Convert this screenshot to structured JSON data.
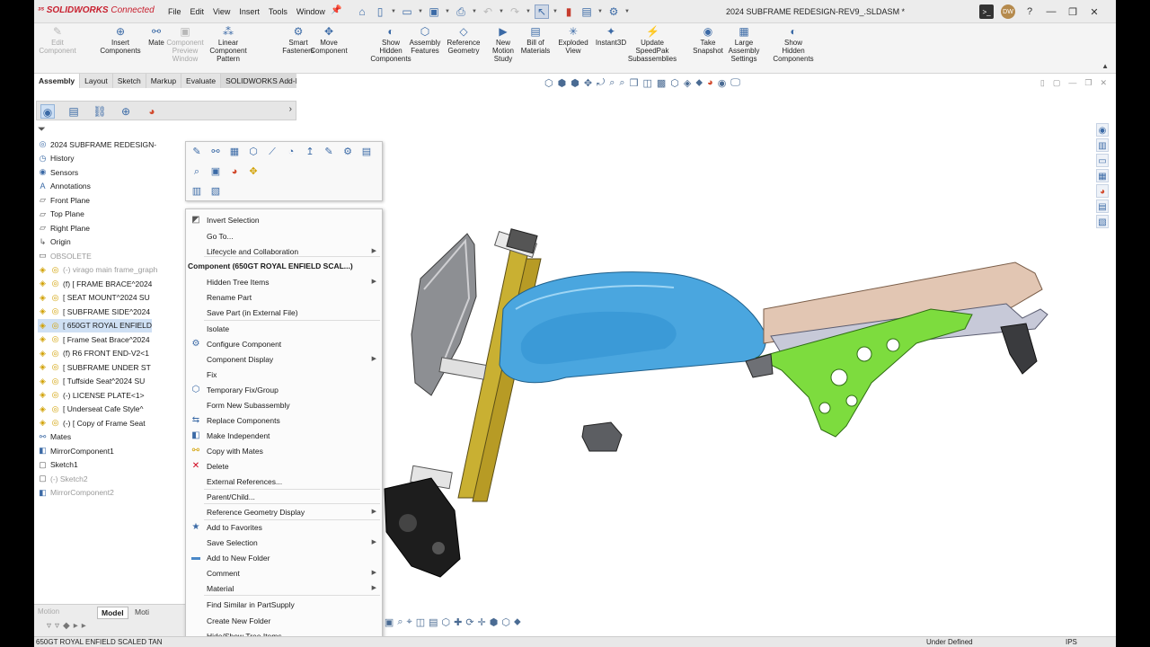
{
  "app": {
    "logo": "SOLIDWORKS",
    "logo_suffix": "Connected",
    "document_title": "2024 SUBFRAME REDESIGN-REV9_.SLDASM *"
  },
  "menubar": [
    "File",
    "Edit",
    "View",
    "Insert",
    "Tools",
    "Window"
  ],
  "window_controls": {
    "avatar_initials": "DW"
  },
  "ribbon": [
    {
      "label": "Edit\nComponent",
      "icon": "edit-component-icon",
      "disabled": true
    },
    {
      "label": "Insert\nComponents",
      "icon": "insert-components-icon",
      "disabled": false
    },
    {
      "label": "Mate",
      "icon": "mate-icon",
      "disabled": false
    },
    {
      "label": "Component\nPreview\nWindow",
      "icon": "preview-window-icon",
      "disabled": true
    },
    {
      "label": "Linear Component\nPattern",
      "icon": "pattern-icon",
      "disabled": false
    },
    {
      "label": "Smart\nFasteners",
      "icon": "fastener-icon",
      "disabled": false
    },
    {
      "label": "Move\nComponent",
      "icon": "move-icon",
      "disabled": false
    },
    {
      "label": "Show\nHidden\nComponents",
      "icon": "show-hidden-icon",
      "disabled": false
    },
    {
      "label": "Assembly\nFeatures",
      "icon": "assembly-features-icon",
      "disabled": false
    },
    {
      "label": "Reference\nGeometry",
      "icon": "reference-geometry-icon",
      "disabled": false
    },
    {
      "label": "New\nMotion\nStudy",
      "icon": "motion-study-icon",
      "disabled": false
    },
    {
      "label": "Bill of\nMaterials",
      "icon": "bom-icon",
      "disabled": false
    },
    {
      "label": "Exploded\nView",
      "icon": "exploded-view-icon",
      "disabled": false
    },
    {
      "label": "Instant3D",
      "icon": "instant3d-icon",
      "disabled": false
    },
    {
      "label": "Update\nSpeedPak\nSubassemblies",
      "icon": "speedpak-icon",
      "disabled": false
    },
    {
      "label": "Take\nSnapshot",
      "icon": "snapshot-icon",
      "disabled": false
    },
    {
      "label": "Large\nAssembly\nSettings",
      "icon": "large-assembly-icon",
      "disabled": false
    },
    {
      "label": "Show\nHidden\nComponents",
      "icon": "show-hidden-icon",
      "disabled": false
    }
  ],
  "command_tabs": [
    "Assembly",
    "Layout",
    "Sketch",
    "Markup",
    "Evaluate",
    "SOLIDWORKS Add-Ins"
  ],
  "tree": [
    {
      "label": "2024 SUBFRAME REDESIGN-",
      "icon": "assembly-icon",
      "dim": false,
      "hl": false
    },
    {
      "label": "History",
      "icon": "history-icon",
      "dim": false,
      "hl": false
    },
    {
      "label": "Sensors",
      "icon": "sensors-icon",
      "dim": false,
      "hl": false
    },
    {
      "label": "Annotations",
      "icon": "annotations-icon",
      "dim": false,
      "hl": false
    },
    {
      "label": "Front Plane",
      "icon": "plane-icon",
      "dim": false,
      "hl": false
    },
    {
      "label": "Top Plane",
      "icon": "plane-icon",
      "dim": false,
      "hl": false
    },
    {
      "label": "Right Plane",
      "icon": "plane-icon",
      "dim": false,
      "hl": false
    },
    {
      "label": "Origin",
      "icon": "origin-icon",
      "dim": false,
      "hl": false
    },
    {
      "label": "OBSOLETE",
      "icon": "folder-icon",
      "dim": true,
      "hl": false
    },
    {
      "label": "(-) virago main frame_graph",
      "icon": "part-icon",
      "dim": true,
      "hl": false
    },
    {
      "label": "(f) [ FRAME BRACE^2024",
      "icon": "part-icon",
      "dim": false,
      "hl": false
    },
    {
      "label": "[ SEAT MOUNT^2024 SU",
      "icon": "part-icon",
      "dim": false,
      "hl": false
    },
    {
      "label": "[ SUBFRAME SIDE^2024",
      "icon": "part-icon",
      "dim": false,
      "hl": false
    },
    {
      "label": "[ 650GT ROYAL ENFIELD",
      "icon": "part-icon",
      "dim": false,
      "hl": true
    },
    {
      "label": "[ Frame Seat Brace^2024",
      "icon": "part-icon",
      "dim": false,
      "hl": false
    },
    {
      "label": "(f) R6 FRONT END-V2<1",
      "icon": "part-icon",
      "dim": false,
      "hl": false
    },
    {
      "label": "[ SUBFRAME UNDER ST",
      "icon": "part-icon",
      "dim": false,
      "hl": false
    },
    {
      "label": "[ Tuffside Seat^2024 SU",
      "icon": "part-icon",
      "dim": false,
      "hl": false
    },
    {
      "label": "(-) LICENSE PLATE<1>",
      "icon": "part-icon",
      "dim": false,
      "hl": false
    },
    {
      "label": "[ Underseat Cafe Style^",
      "icon": "part-icon",
      "dim": false,
      "hl": false
    },
    {
      "label": "(-) [ Copy of Frame Seat",
      "icon": "part-icon",
      "dim": false,
      "hl": false
    },
    {
      "label": "Mates",
      "icon": "mates-icon",
      "dim": false,
      "hl": false
    },
    {
      "label": "MirrorComponent1",
      "icon": "mirror-icon",
      "dim": false,
      "hl": false
    },
    {
      "label": "Sketch1",
      "icon": "sketch-icon",
      "dim": false,
      "hl": false
    },
    {
      "label": "(-) Sketch2",
      "icon": "sketch-icon",
      "dim": true,
      "hl": false
    },
    {
      "label": "MirrorComponent2",
      "icon": "mirror-icon",
      "dim": true,
      "hl": false
    }
  ],
  "fm_bottom": {
    "model_tab": "Model",
    "motion_tab": "Moti",
    "motion_label": "Motion"
  },
  "context_menu": [
    {
      "label": "Invert Selection",
      "icon": "invert-selection-icon",
      "sub": false,
      "header": false
    },
    {
      "label": "Go To...",
      "icon": "",
      "sub": false,
      "header": false
    },
    {
      "label": "Lifecycle and Collaboration",
      "icon": "",
      "sub": true,
      "header": false
    },
    {
      "label": "Component (650GT ROYAL ENFIELD SCAL...)",
      "icon": "",
      "sub": false,
      "header": true
    },
    {
      "label": "Hidden Tree Items",
      "icon": "",
      "sub": true,
      "header": false
    },
    {
      "label": "Rename Part",
      "icon": "",
      "sub": false,
      "header": false
    },
    {
      "label": "Save Part (in External File)",
      "icon": "",
      "sub": false,
      "header": false
    },
    {
      "label": "Isolate",
      "icon": "",
      "sub": false,
      "header": false
    },
    {
      "label": "Configure Component",
      "icon": "configure-icon",
      "sub": false,
      "header": false
    },
    {
      "label": "Component Display",
      "icon": "",
      "sub": true,
      "header": false
    },
    {
      "label": "Fix",
      "icon": "",
      "sub": false,
      "header": false
    },
    {
      "label": "Temporary Fix/Group",
      "icon": "fix-group-icon",
      "sub": false,
      "header": false
    },
    {
      "label": "Form New Subassembly",
      "icon": "",
      "sub": false,
      "header": false
    },
    {
      "label": "Replace Components",
      "icon": "replace-icon",
      "sub": false,
      "header": false
    },
    {
      "label": "Make Independent",
      "icon": "independent-icon",
      "sub": false,
      "header": false
    },
    {
      "label": "Copy with Mates",
      "icon": "copy-mates-icon",
      "sub": false,
      "header": false
    },
    {
      "label": "Delete",
      "icon": "delete-icon",
      "sub": false,
      "header": false
    },
    {
      "label": "External References...",
      "icon": "",
      "sub": false,
      "header": false
    },
    {
      "label": "Parent/Child...",
      "icon": "",
      "sub": false,
      "header": false
    },
    {
      "label": "Reference Geometry Display",
      "icon": "",
      "sub": true,
      "header": false
    },
    {
      "label": "Add to Favorites",
      "icon": "favorites-icon",
      "sub": false,
      "header": false
    },
    {
      "label": "Save Selection",
      "icon": "",
      "sub": true,
      "header": false
    },
    {
      "label": "Add to New Folder",
      "icon": "folder-icon",
      "sub": false,
      "header": false
    },
    {
      "label": "Comment",
      "icon": "",
      "sub": true,
      "header": false
    },
    {
      "label": "Material",
      "icon": "",
      "sub": true,
      "header": false
    },
    {
      "label": "Find Similar in PartSupply",
      "icon": "",
      "sub": false,
      "header": false
    },
    {
      "label": "Create New Folder",
      "icon": "",
      "sub": false,
      "header": false
    },
    {
      "label": "Hide/Show Tree Items...",
      "icon": "",
      "sub": false,
      "header": false
    }
  ],
  "status": {
    "selection": "650GT ROYAL ENFIELD SCALED TAN",
    "state": "Under Defined",
    "units": "IPS"
  },
  "colors": {
    "tank": "#4aa6df",
    "subframe": "#7ddc3e",
    "fork": "#c9b032",
    "seat": "#e2c6b3",
    "brand": "#c8202f"
  }
}
